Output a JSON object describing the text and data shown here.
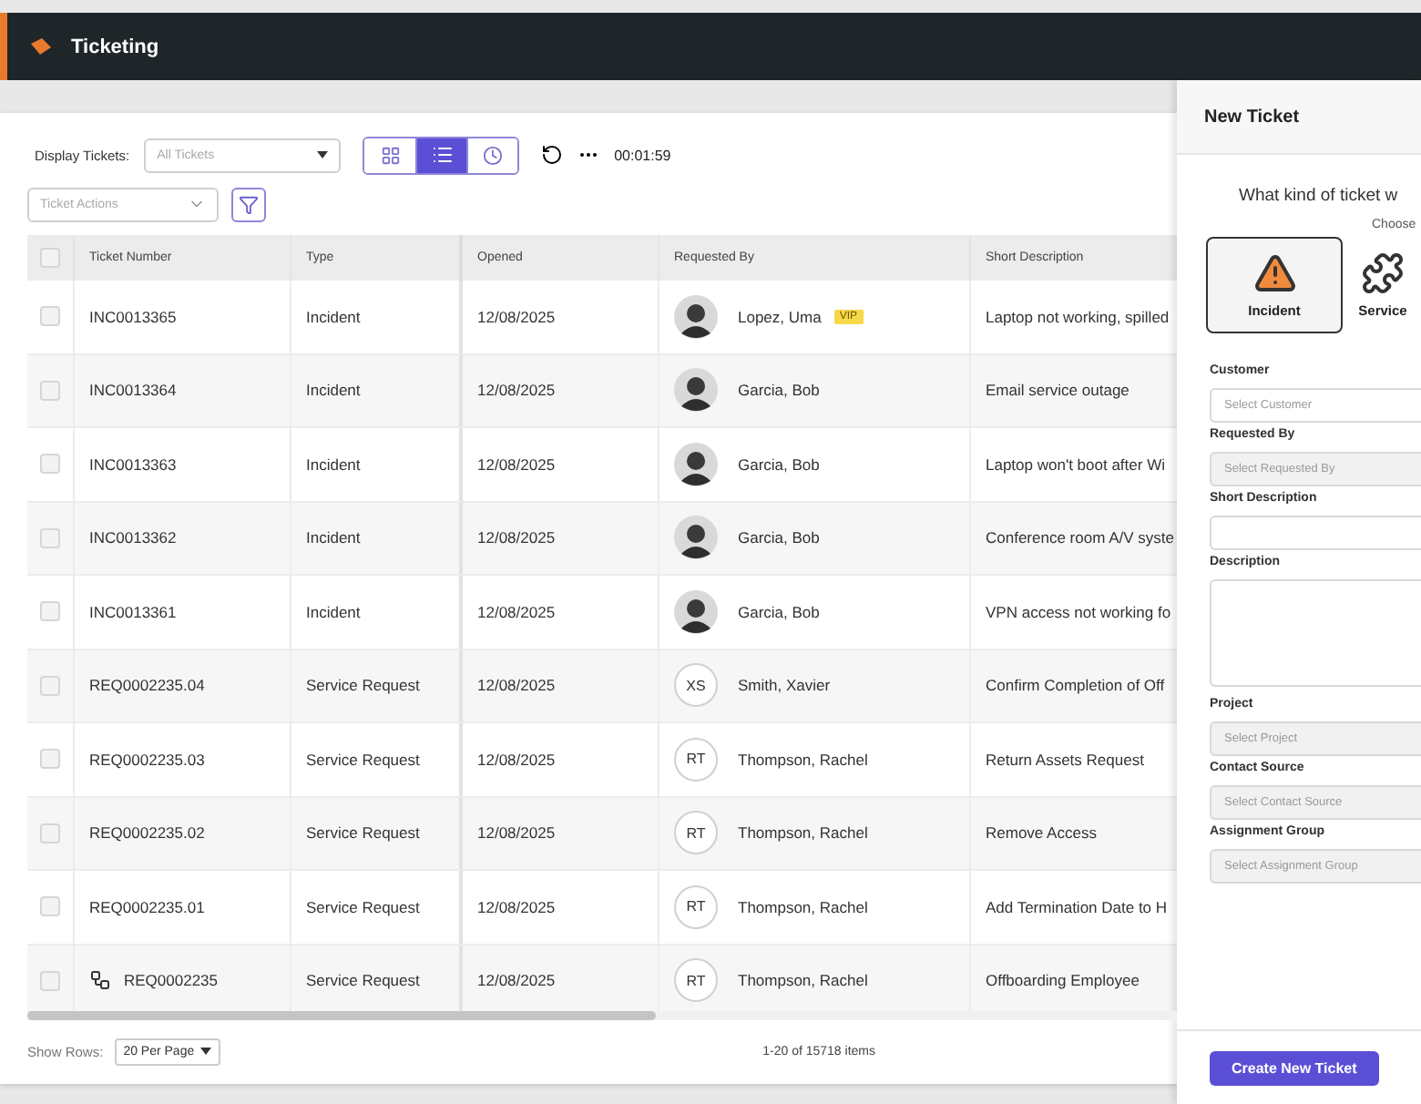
{
  "app": {
    "title": "Ticketing"
  },
  "toolbar": {
    "display_label": "Display Tickets:",
    "display_placeholder": "All Tickets",
    "views": [
      {
        "kind": "grid",
        "selected": false
      },
      {
        "kind": "list",
        "selected": true
      },
      {
        "kind": "clock",
        "selected": false
      }
    ],
    "timer": "00:01:59",
    "actions_placeholder": "Ticket Actions"
  },
  "table": {
    "select_all": {
      "checked": false
    },
    "columns": [
      "Ticket Number",
      "Type",
      "Opened",
      "Requested By",
      "Short Description"
    ],
    "rows": [
      {
        "kind": "ticket",
        "checked": false,
        "number": "INC0013365",
        "type": "Incident",
        "opened": "12/08/2025",
        "avatar": {
          "kind": "photo"
        },
        "requester": "Lopez, Uma",
        "badge": "VIP",
        "description": "Laptop not working, spilled"
      },
      {
        "kind": "ticket",
        "checked": false,
        "number": "INC0013364",
        "type": "Incident",
        "opened": "12/08/2025",
        "avatar": {
          "kind": "photo"
        },
        "requester": "Garcia, Bob",
        "description": "Email service outage"
      },
      {
        "kind": "ticket",
        "checked": false,
        "number": "INC0013363",
        "type": "Incident",
        "opened": "12/08/2025",
        "avatar": {
          "kind": "photo"
        },
        "requester": "Garcia, Bob",
        "description": "Laptop won't boot after Wi"
      },
      {
        "kind": "ticket",
        "checked": false,
        "number": "INC0013362",
        "type": "Incident",
        "opened": "12/08/2025",
        "avatar": {
          "kind": "photo"
        },
        "requester": "Garcia, Bob",
        "description": "Conference room A/V syste"
      },
      {
        "kind": "ticket",
        "checked": false,
        "number": "INC0013361",
        "type": "Incident",
        "opened": "12/08/2025",
        "avatar": {
          "kind": "photo"
        },
        "requester": "Garcia, Bob",
        "description": "VPN access not working fo"
      },
      {
        "kind": "ticket",
        "checked": false,
        "number": "REQ0002235.04",
        "type": "Service Request",
        "opened": "12/08/2025",
        "avatar": {
          "kind": "initials",
          "initials": "XS"
        },
        "requester": "Smith, Xavier",
        "description": "Confirm Completion of Off"
      },
      {
        "kind": "ticket",
        "checked": false,
        "number": "REQ0002235.03",
        "type": "Service Request",
        "opened": "12/08/2025",
        "avatar": {
          "kind": "initials",
          "initials": "RT"
        },
        "requester": "Thompson, Rachel",
        "description": "Return Assets Request"
      },
      {
        "kind": "ticket",
        "checked": false,
        "number": "REQ0002235.02",
        "type": "Service Request",
        "opened": "12/08/2025",
        "avatar": {
          "kind": "initials",
          "initials": "RT"
        },
        "requester": "Thompson, Rachel",
        "description": "Remove Access"
      },
      {
        "kind": "ticket",
        "checked": false,
        "number": "REQ0002235.01",
        "type": "Service Request",
        "opened": "12/08/2025",
        "avatar": {
          "kind": "initials",
          "initials": "RT"
        },
        "requester": "Thompson, Rachel",
        "description": "Add Termination Date to H"
      },
      {
        "kind": "parent",
        "checked": false,
        "number": "REQ0002235",
        "type": "Service Request",
        "opened": "12/08/2025",
        "avatar": {
          "kind": "initials",
          "initials": "RT"
        },
        "requester": "Thompson, Rachel",
        "description": "Offboarding Employee"
      }
    ]
  },
  "footer": {
    "rows_label": "Show Rows:",
    "rows_value": "20 Per Page",
    "count": "1-20 of 15718 items"
  },
  "panel": {
    "title": "New Ticket",
    "question": "What kind of ticket w",
    "hint": "Choose",
    "types": [
      {
        "kind": "incident",
        "label": "Incident",
        "selected": true
      },
      {
        "kind": "service",
        "label": "Service",
        "selected": false
      }
    ],
    "fields": [
      {
        "kind": "select",
        "label": "Customer",
        "placeholder": "Select Customer",
        "disabled": false
      },
      {
        "kind": "select",
        "label": "Requested By",
        "placeholder": "Select Requested By",
        "disabled": true
      },
      {
        "kind": "input",
        "label": "Short Description",
        "disabled": false
      },
      {
        "kind": "textarea",
        "label": "Description",
        "disabled": false
      },
      {
        "kind": "select",
        "label": "Project",
        "placeholder": "Select Project",
        "disabled": true
      },
      {
        "kind": "select",
        "label": "Contact Source",
        "placeholder": "Select Contact Source",
        "disabled": true
      },
      {
        "kind": "select",
        "label": "Assignment Group",
        "placeholder": "Select Assignment Group",
        "disabled": true
      }
    ],
    "submit": "Create New Ticket"
  }
}
